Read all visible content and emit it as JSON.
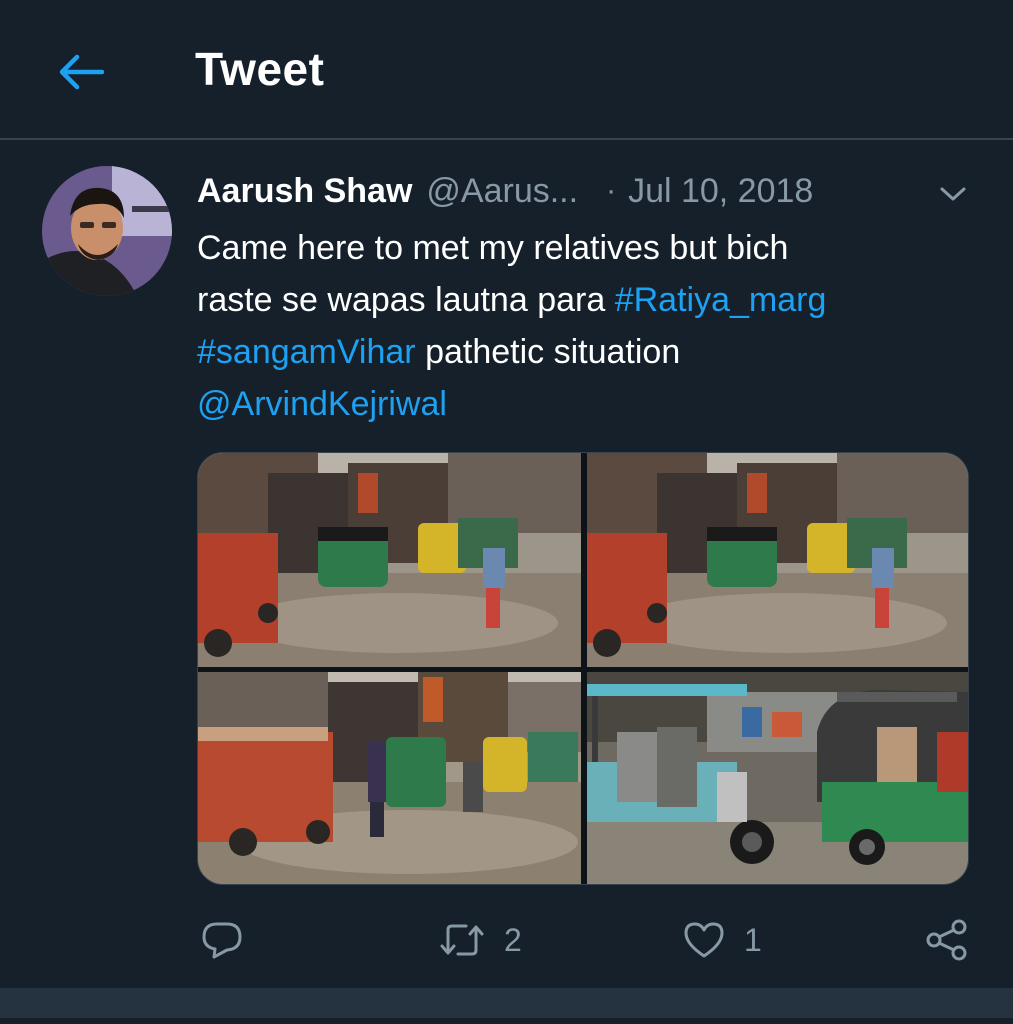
{
  "header": {
    "back_icon": "arrow-left-icon",
    "title": "Tweet"
  },
  "tweet": {
    "author": {
      "display_name": "Aarush Shaw",
      "handle": "@Aarus...",
      "avatar_icon": "user-avatar"
    },
    "separator": "·",
    "date": "Jul 10, 2018",
    "text": {
      "line1": "Came here to met my relatives but bich",
      "line2_plain": "raste se wapas lautna para ",
      "hashtag1": "#Ratiya_marg",
      "hashtag2": "#sangamVihar",
      "line3_plain": " pathetic situation",
      "mention": "@ArvindKejriwal"
    },
    "media": {
      "photo_count": 4
    }
  },
  "actions": {
    "reply": {
      "icon": "reply-icon",
      "count": ""
    },
    "retweet": {
      "icon": "retweet-icon",
      "count": "2"
    },
    "like": {
      "icon": "heart-icon",
      "count": "1"
    },
    "share": {
      "icon": "share-icon"
    }
  },
  "colors": {
    "background": "#15202b",
    "accent": "#1da1f2",
    "secondary_text": "#8899a6",
    "divider": "#38444d"
  }
}
